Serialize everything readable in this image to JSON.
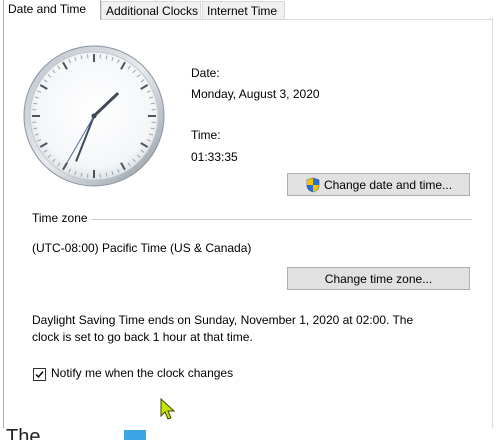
{
  "tabs": [
    {
      "label": "Date and Time",
      "active": true
    },
    {
      "label": "Additional Clocks",
      "active": false
    },
    {
      "label": "Internet Time",
      "active": false
    }
  ],
  "clock": {
    "hours": 1,
    "minutes": 33,
    "seconds": 35
  },
  "date_section": {
    "date_label": "Date:",
    "date_value": "Monday, August 3, 2020",
    "time_label": "Time:",
    "time_value": "01:33:35",
    "change_button": "Change date and time..."
  },
  "timezone_section": {
    "heading": "Time zone",
    "value": "(UTC-08:00) Pacific Time (US & Canada)",
    "change_button": "Change time zone..."
  },
  "dst": {
    "line1": "Daylight Saving Time ends on Sunday, November 1, 2020 at 02:00. The",
    "line2": "clock is set to go back 1 hour at that time."
  },
  "notify": {
    "label": "Notify me when the clock changes",
    "checked": true
  },
  "bottom": {
    "text": "The"
  },
  "colors": {
    "accent": "#0078d7",
    "button_bg": "#e1e1e1",
    "cursor": "#c6e400"
  },
  "icons": [
    "uac-shield-icon",
    "checkmark-icon",
    "mouse-cursor-icon"
  ]
}
